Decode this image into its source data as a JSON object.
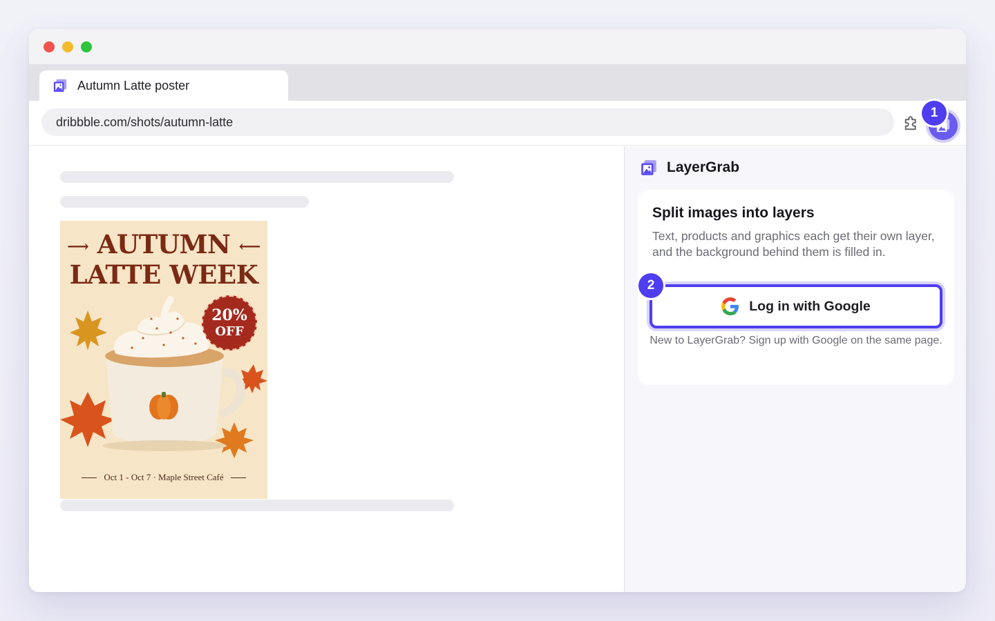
{
  "window": {
    "tab_title": "Autumn Latte poster",
    "url": "dribbble.com/shots/autumn-latte"
  },
  "toolbar": {
    "extensions_icon": "puzzle-icon",
    "active_extension_icon": "layergrab-icon",
    "badge_1": "1"
  },
  "poster": {
    "headline_line1": "AUTUMN",
    "headline_line2": "LATTE WEEK",
    "discount_value": "20%",
    "discount_label": "OFF",
    "footer": "Oct 1 - Oct 7 · Maple Street Café"
  },
  "sidepanel": {
    "brand_name": "LayerGrab",
    "card_title": "Split images into layers",
    "card_description": "Text, products and graphics each get their own layer, and the background behind them is filled in.",
    "login_button_label": "Log in with Google",
    "badge_2": "2",
    "footnote": "New to LayerGrab? Sign up with Google on the same page."
  },
  "colors": {
    "accent": "#4f3df0",
    "extension": "#6a5cf0",
    "poster_bg": "#f7e5c7",
    "poster_title": "#7a2a14",
    "discount_red": "#a52a1e"
  }
}
